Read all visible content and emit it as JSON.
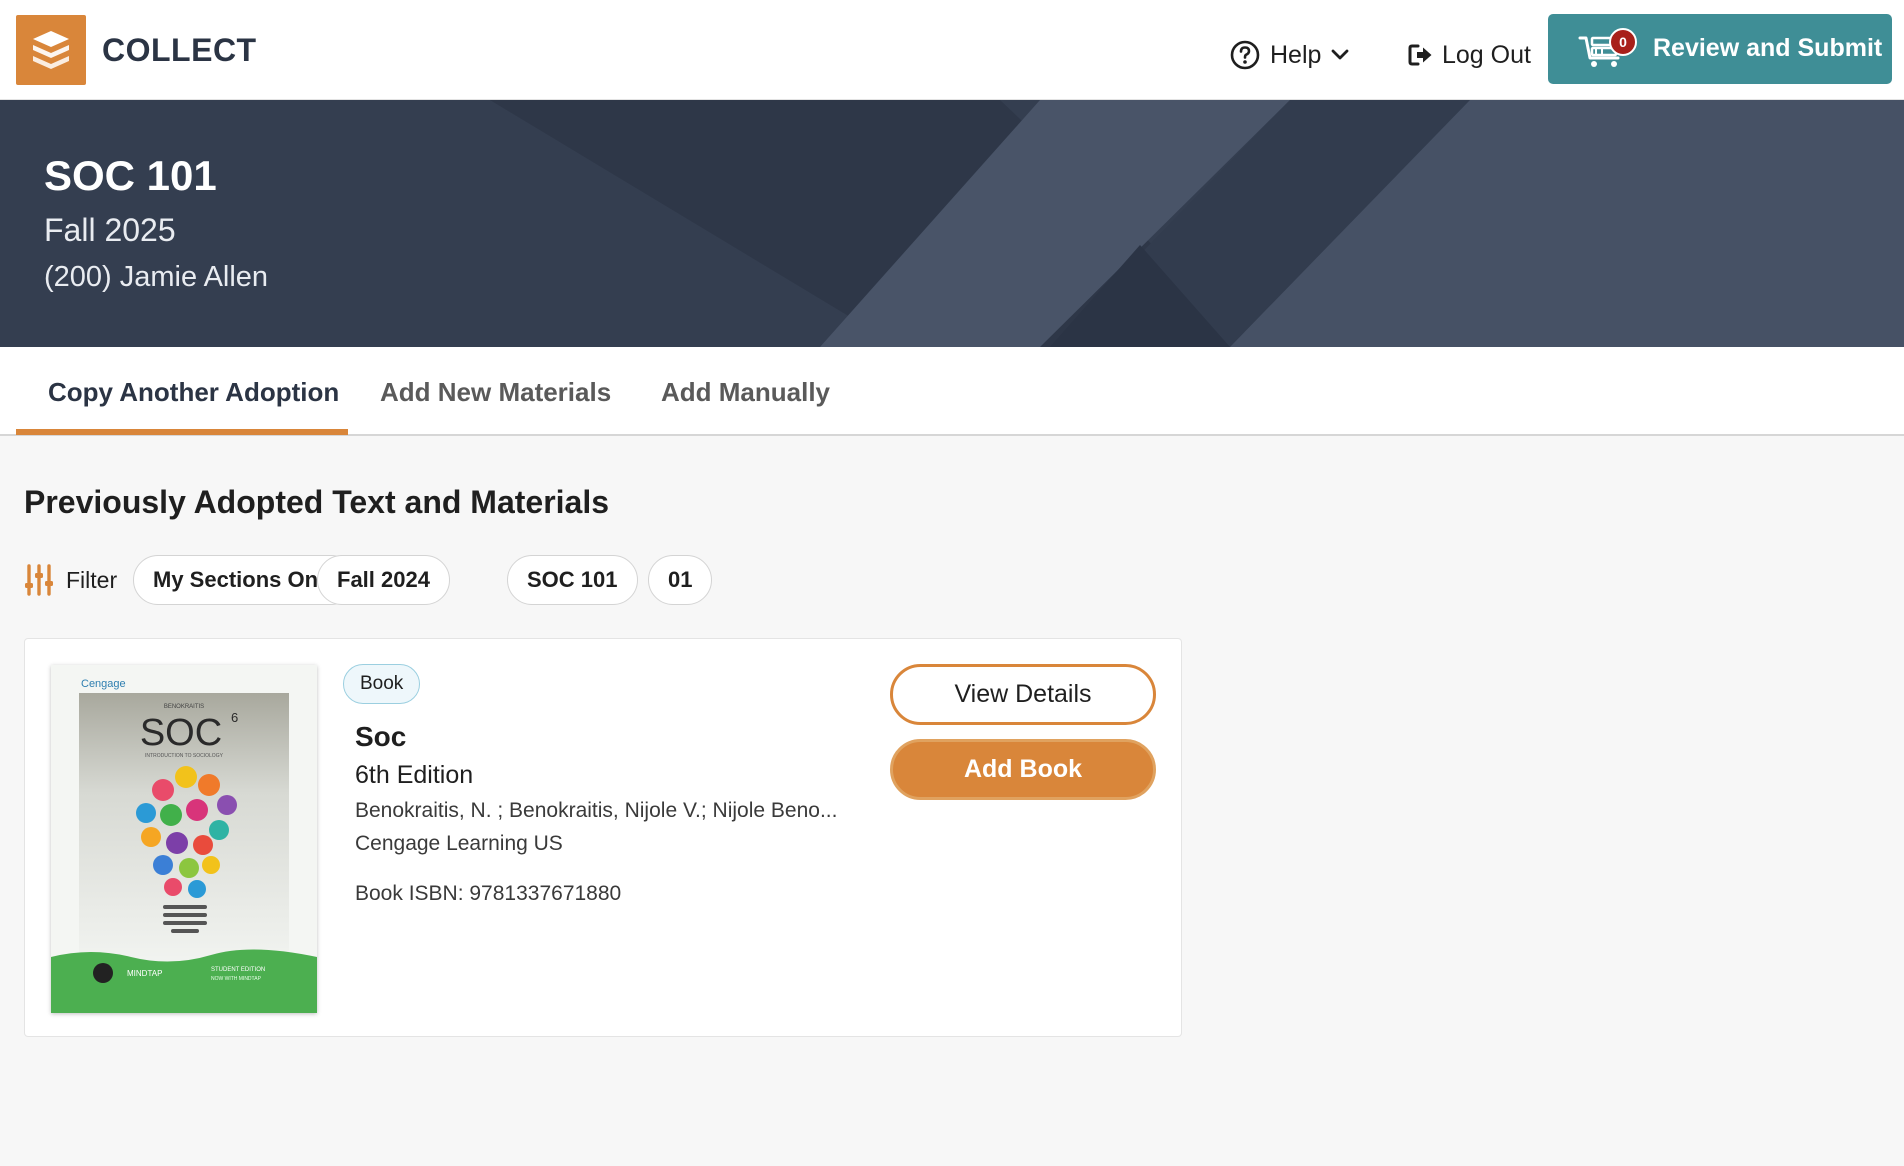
{
  "app": {
    "title": "COLLECT"
  },
  "header": {
    "help_label": "Help",
    "logout_label": "Log Out",
    "review_label": "Review and Submit",
    "cart_count": "0"
  },
  "course": {
    "code": "SOC 101",
    "term": "Fall 2025",
    "instructor": "(200) Jamie Allen"
  },
  "tabs": [
    {
      "label": "Copy Another Adoption",
      "active": true
    },
    {
      "label": "Add New Materials",
      "active": false
    },
    {
      "label": "Add Manually",
      "active": false
    }
  ],
  "main": {
    "section_title": "Previously Adopted Text and Materials",
    "filter_label": "Filter",
    "filters": [
      "My Sections Only",
      "Fall 2024",
      "SOC 101",
      "01"
    ]
  },
  "results": [
    {
      "type": "Book",
      "title": "Soc",
      "edition": "6th Edition",
      "authors": "Benokraitis, N. ; Benokraitis, Nijole V.; Nijole Beno...",
      "publisher": "Cengage Learning US",
      "isbn": "Book ISBN: 9781337671880",
      "cover": {
        "brand": "Cengage",
        "author": "BENOKRAITIS",
        "title": "SOC",
        "edition_mark": "6",
        "subtitle": "INTRODUCTION TO SOCIOLOGY",
        "footer_left": "MINDTAP",
        "footer_right_top": "STUDENT EDITION",
        "footer_right_bottom": "NOW WITH MINDTAP"
      },
      "view_label": "View Details",
      "add_label": "Add Book"
    }
  ],
  "colors": {
    "accent": "#d9863a",
    "teal": "#3f8e96",
    "hero": "#343e50",
    "badge": "#a8201a"
  }
}
